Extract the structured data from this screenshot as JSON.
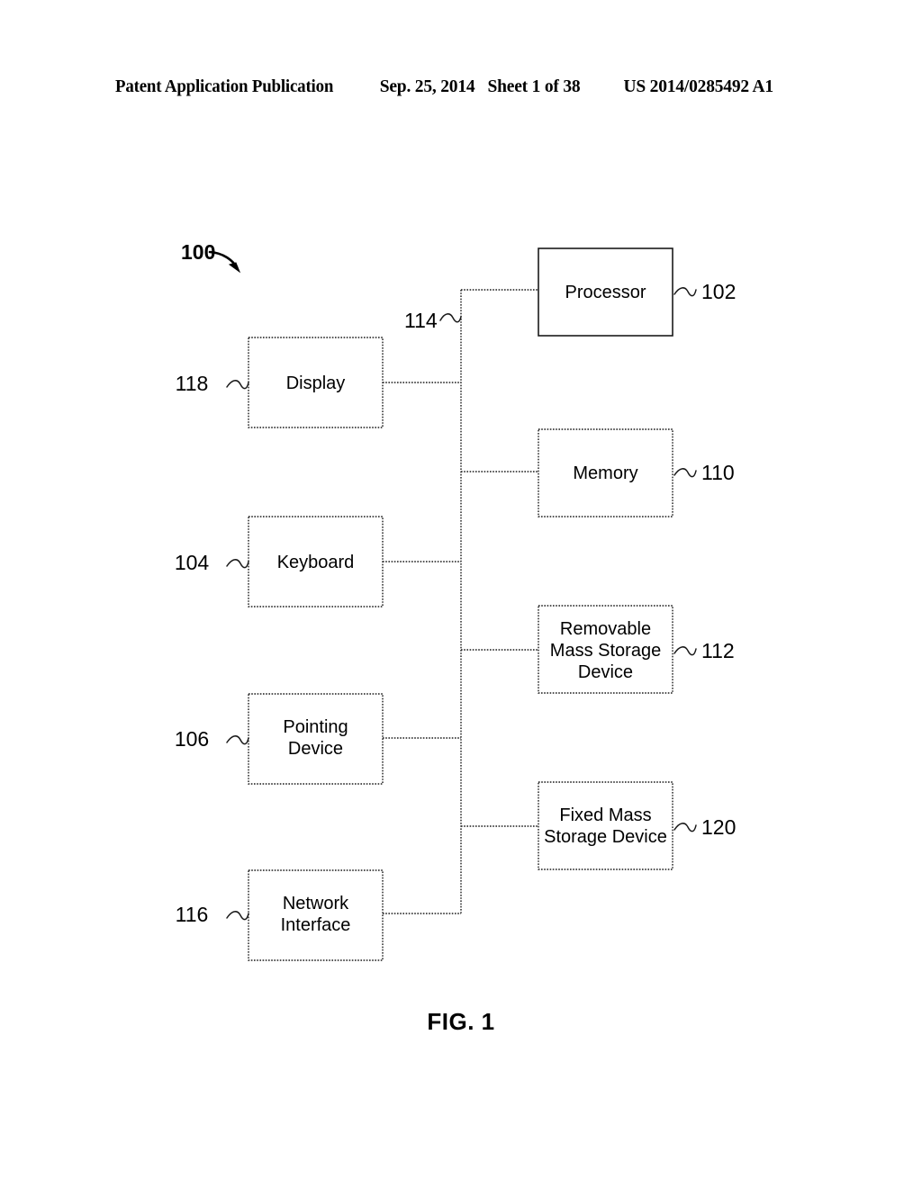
{
  "header": {
    "publication": "Patent Application Publication",
    "date": "Sep. 25, 2014",
    "sheet": "Sheet 1 of 38",
    "document_number": "US 2014/0285492 A1"
  },
  "figure": {
    "caption": "FIG. 1",
    "system_callout": "100",
    "bus_ref": "114",
    "colors": {
      "ink": "#1a1a1a",
      "background": "#ffffff"
    }
  },
  "blocks": {
    "processor": {
      "label": "Processor",
      "ref": "102"
    },
    "memory": {
      "label": "Memory",
      "ref": "110"
    },
    "removable_storage": {
      "label": "Removable\nMass Storage\nDevice",
      "ref": "112",
      "line1": "Removable",
      "line2": "Mass Storage",
      "line3": "Device"
    },
    "fixed_storage": {
      "label": "Fixed Mass\nStorage Device",
      "ref": "120",
      "line1": "Fixed Mass",
      "line2": "Storage Device"
    },
    "display": {
      "label": "Display",
      "ref": "118"
    },
    "keyboard": {
      "label": "Keyboard",
      "ref": "104"
    },
    "pointing_device": {
      "label": "Pointing\nDevice",
      "ref": "106",
      "line1": "Pointing",
      "line2": "Device"
    },
    "network_interface": {
      "label": "Network\nInterface",
      "ref": "116",
      "line1": "Network",
      "line2": "Interface"
    }
  }
}
